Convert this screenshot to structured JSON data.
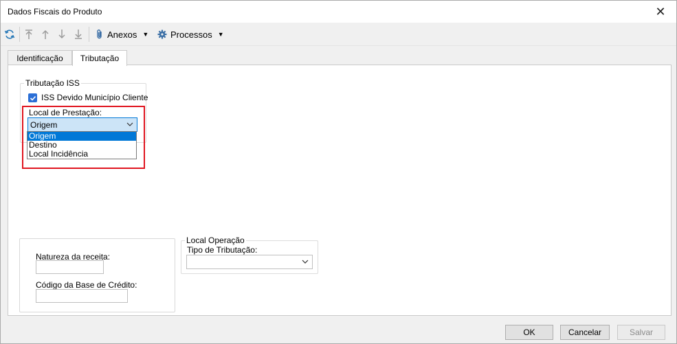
{
  "window": {
    "title": "Dados Fiscais do Produto",
    "close_glyph": "✕"
  },
  "toolbar": {
    "anexos_label": "Anexos",
    "processos_label": "Processos",
    "icons": [
      "refresh-icon",
      "move-first-icon",
      "move-up-icon",
      "move-down-icon",
      "move-last-icon",
      "paperclip-icon",
      "gear-icon"
    ]
  },
  "tabs": [
    {
      "label": "Identificação",
      "active": false
    },
    {
      "label": "Tributação",
      "active": true
    }
  ],
  "tributacao_iss": {
    "legend": "Tributação ISS",
    "checkbox_label": "ISS Devido Município Cliente",
    "checkbox_checked": true,
    "local_prestacao_label": "Local de Prestação:",
    "selected_value": "Origem",
    "options": [
      "Origem",
      "Destino",
      "Local Incidência"
    ],
    "dropdown_open": true,
    "highlighted_option": "Origem"
  },
  "natureza_group": {
    "natureza_label": "Natureza da receita:",
    "natureza_value": "",
    "codigo_label": "Código da Base de Crédito:",
    "codigo_value": ""
  },
  "local_operacao": {
    "legend": "Local Operação",
    "tipo_label": "Tipo de Tributação:",
    "tipo_value": ""
  },
  "footer": {
    "ok_label": "OK",
    "cancel_label": "Cancelar",
    "save_label": "Salvar",
    "save_enabled": false
  },
  "colors": {
    "accent": "#0078d7",
    "checkbox": "#2b6fd6",
    "highlight_box": "#e0141e"
  }
}
